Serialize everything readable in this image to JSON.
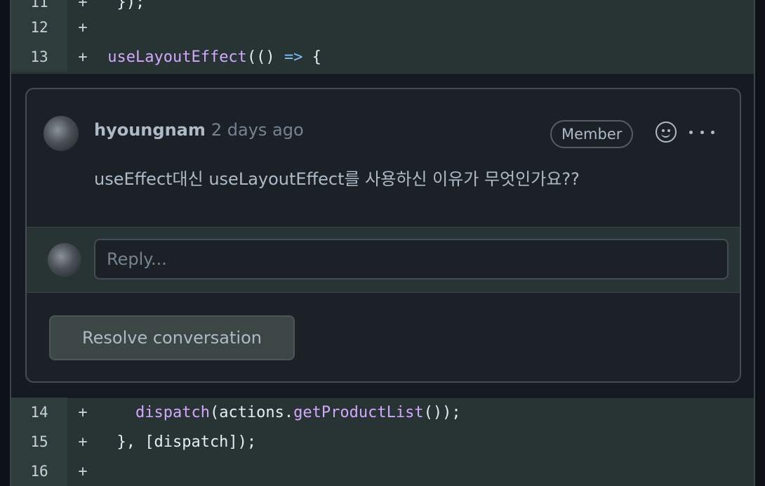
{
  "diff_top": [
    {
      "num": "11",
      "sign": "+",
      "code": "  });"
    },
    {
      "num": "12",
      "sign": "+",
      "code": ""
    },
    {
      "num": "13",
      "sign": "+",
      "fn": "useLayoutEffect",
      "rest": "(() ",
      "op": "=>",
      "tail": " {"
    }
  ],
  "comment": {
    "author": "hyoungnam",
    "time": "2 days ago",
    "badge": "Member",
    "body": "useEffect대신 useLayoutEffect를 사용하신 이유가 무엇인가요??",
    "reaction_icon": "smiley-icon",
    "more_icon": "kebab-horizontal-icon"
  },
  "reply": {
    "placeholder": "Reply..."
  },
  "resolve_label": "Resolve conversation",
  "diff_bottom": [
    {
      "num": "14",
      "sign": "+",
      "pre": "    ",
      "fn": "dispatch",
      "mid": "(actions.",
      "fn2": "getProductList",
      "post": "());"
    },
    {
      "num": "15",
      "sign": "+",
      "code": "  }, [dispatch]);"
    },
    {
      "num": "16",
      "sign": "+",
      "code": ""
    }
  ],
  "colors": {
    "added_line_bg": "#273433",
    "gutter_bg": "#2e3d3b",
    "function_color": "#d2a8ff",
    "operator_color": "#79c0ff"
  }
}
